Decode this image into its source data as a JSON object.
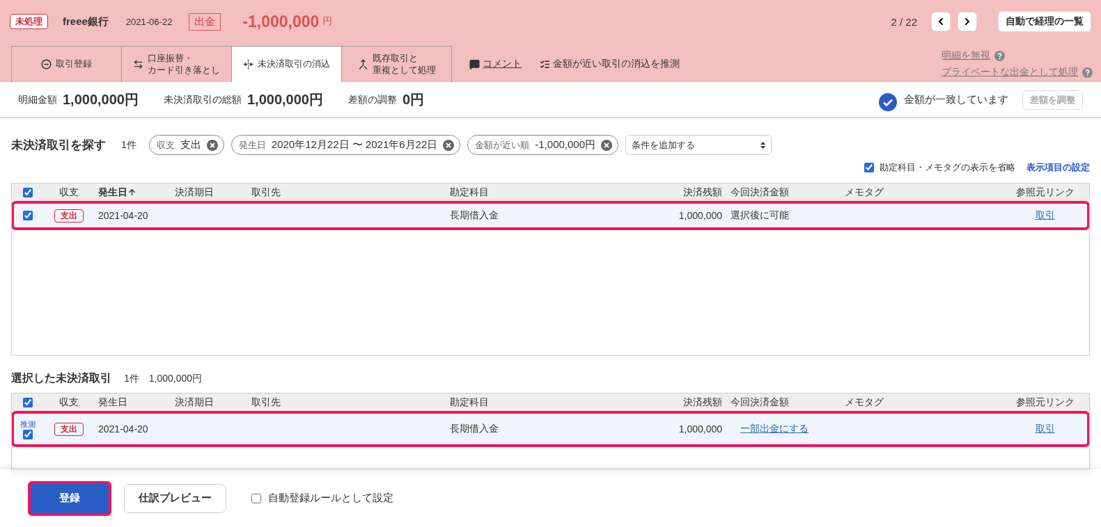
{
  "header": {
    "status_badge": "未処理",
    "bank": "freee銀行",
    "date": "2021-06-22",
    "direction": "出金",
    "amount": "-1,000,000",
    "currency": "円",
    "pager": "2 / 22",
    "list_button": "自動で経理の一覧"
  },
  "tabs": [
    {
      "lines": [
        "取引登録"
      ],
      "selected": false
    },
    {
      "lines": [
        "口座振替・",
        "カード引き落とし"
      ],
      "selected": false
    },
    {
      "lines": [
        "未決済取引の消込"
      ],
      "selected": true
    },
    {
      "lines": [
        "既存取引と",
        "重複として処理"
      ],
      "selected": false
    }
  ],
  "actions": [
    {
      "label": "コメント",
      "kind": "link"
    },
    {
      "label": "金額が近い取引の消込を推測",
      "kind": "plain"
    }
  ],
  "side_links": [
    "明細を無視",
    "プライベートな出金として処理"
  ],
  "summary": {
    "items": [
      {
        "label": "明細金額",
        "value": "1,000,000円"
      },
      {
        "label": "未決済取引の総額",
        "value": "1,000,000円"
      },
      {
        "label": "差額の調整",
        "value": "0円"
      }
    ],
    "match_status": "金額が一致しています",
    "adjust_button": {
      "label": "差額を調整",
      "disabled": true
    }
  },
  "search": {
    "title": "未決済取引を探す",
    "count": "1件",
    "filters": [
      {
        "label": "収支",
        "value": "支出"
      },
      {
        "label": "発生日",
        "value": "2020年12月22日 〜 2021年6月22日"
      },
      {
        "label": "金額が近い順",
        "value": "-1,000,000円"
      }
    ],
    "add_select": "条件を追加する",
    "omit_checkbox": {
      "label": "勘定科目・メモタグの表示を省略",
      "checked": true
    },
    "settings_link": "表示項目の設定"
  },
  "search_table": {
    "header_checked": true,
    "columns": [
      {
        "kind": "check"
      },
      {
        "label": "収支",
        "kind": "center"
      },
      {
        "label": "発生日",
        "kind": "sorted"
      },
      {
        "label": "決済期日",
        "kind": "text"
      },
      {
        "label": "取引先",
        "kind": "text"
      },
      {
        "label": "勘定科目",
        "kind": "text"
      },
      {
        "label": "決済残額",
        "kind": "right"
      },
      {
        "label": "今回決済金額",
        "kind": "text"
      },
      {
        "label": "メモタグ",
        "kind": "text"
      },
      {
        "label": "参照元リンク",
        "kind": "center"
      }
    ],
    "rows": [
      {
        "checked": true,
        "highlighted": true,
        "type": "支出",
        "date": "2021-04-20",
        "account": "長期借入金",
        "balance": "1,000,000",
        "amount": {
          "kind": "text",
          "label": "選択後に可能"
        },
        "link": "取引"
      }
    ]
  },
  "selected_section": {
    "title": "選択した未決済取引",
    "count": "1件",
    "total": "1,000,000円"
  },
  "selected_table": {
    "header_checked": true,
    "columns": [
      {
        "kind": "check"
      },
      {
        "label": "収支",
        "kind": "center"
      },
      {
        "label": "発生日",
        "kind": "text"
      },
      {
        "label": "決済期日",
        "kind": "text"
      },
      {
        "label": "取引先",
        "kind": "text"
      },
      {
        "label": "勘定科目",
        "kind": "text"
      },
      {
        "label": "決済残額",
        "kind": "right"
      },
      {
        "label": "今回決済金額",
        "kind": "text"
      },
      {
        "label": "メモタグ",
        "kind": "text"
      },
      {
        "label": "参照元リンク",
        "kind": "center"
      }
    ],
    "rows": [
      {
        "checked": true,
        "highlighted": true,
        "guess": "推測",
        "type": "支出",
        "date": "2021-04-20",
        "account": "長期借入金",
        "balance": "1,000,000",
        "amount": {
          "kind": "link",
          "label": "一部出金にする"
        },
        "link": "取引"
      }
    ]
  },
  "footer": {
    "register_button": {
      "label": "登録",
      "highlighted": true
    },
    "preview_button": "仕訳プレビュー",
    "auto_rule": {
      "label": "自動登録ルールとして設定",
      "checked": false
    }
  }
}
